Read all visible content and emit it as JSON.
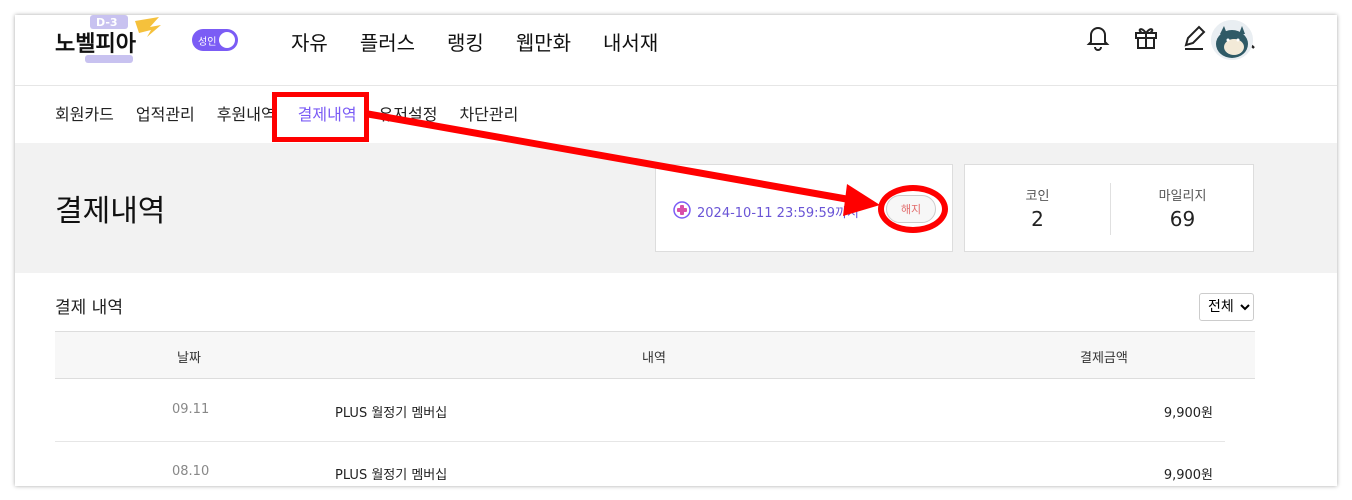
{
  "brand": {
    "logo_text": "노벨피아",
    "badge_text": "D-3",
    "toggle_label": "성인"
  },
  "mainnav": [
    "자유",
    "플러스",
    "랭킹",
    "웹만화",
    "내서재"
  ],
  "header_icons": [
    "bell-icon",
    "gift-icon",
    "pencil-icon",
    "search-icon"
  ],
  "subnav": {
    "items": [
      "회원카드",
      "업적관리",
      "후원내역",
      "결제내역",
      "유저설정",
      "차단관리"
    ],
    "active_index": 3
  },
  "page": {
    "title": "결제내역"
  },
  "subscription": {
    "until": "2024-10-11 23:59:59까지",
    "cancel_label": "해지"
  },
  "stats": {
    "coin_label": "코인",
    "coin_value": "2",
    "mileage_label": "마일리지",
    "mileage_value": "69"
  },
  "history": {
    "title": "결제 내역",
    "filter": {
      "selected": "전체"
    },
    "columns": [
      "날짜",
      "내역",
      "결제금액"
    ],
    "rows": [
      {
        "date": "09.11",
        "item": "PLUS 월정기 멤버십",
        "amount": "9,900원"
      },
      {
        "date": "08.10",
        "item": "PLUS 월정기 멤버십",
        "amount": "9,900원"
      }
    ]
  },
  "colors": {
    "accent": "#7b5cf5",
    "annotation": "#ff0000"
  }
}
